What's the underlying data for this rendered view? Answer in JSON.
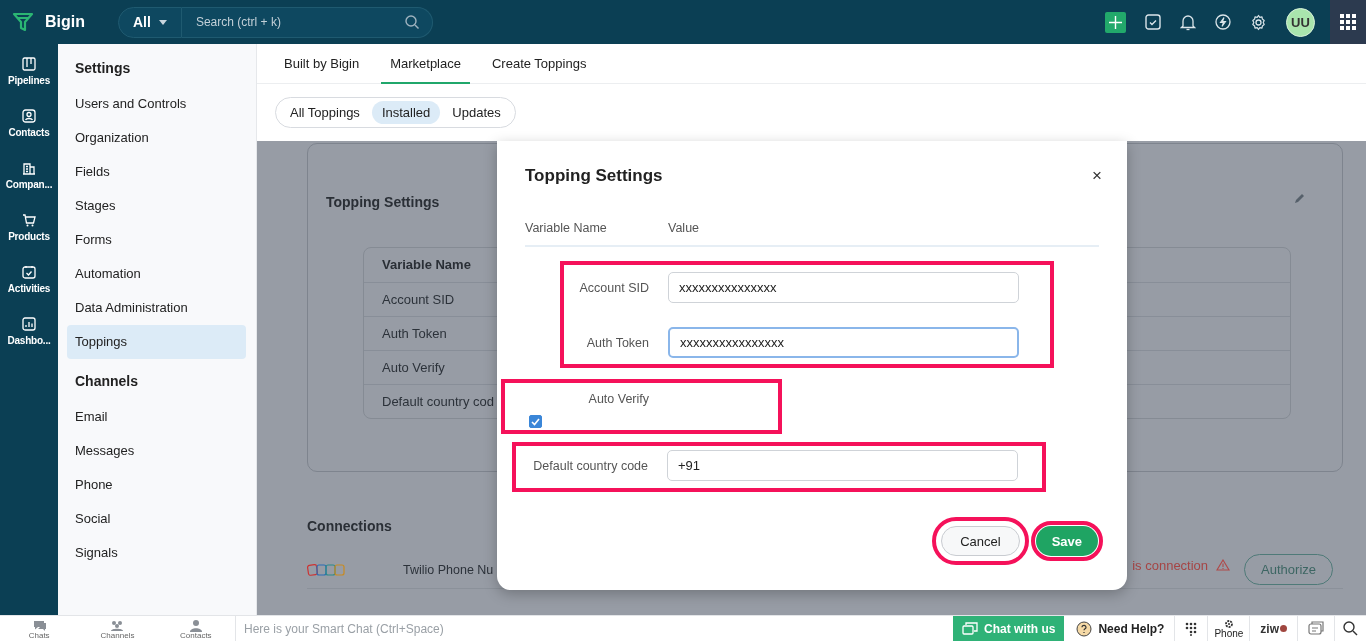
{
  "app": {
    "name": "Bigin"
  },
  "search": {
    "scope": "All",
    "placeholder": "Search (ctrl + k)"
  },
  "user": {
    "initials": "UU"
  },
  "rail": [
    {
      "label": "Pipelines"
    },
    {
      "label": "Contacts"
    },
    {
      "label": "Compan..."
    },
    {
      "label": "Products"
    },
    {
      "label": "Activities"
    },
    {
      "label": "Dashbo..."
    }
  ],
  "settings_nav": [
    {
      "heading": "Settings",
      "items": [
        {
          "label": "Users and Controls",
          "selected": false
        },
        {
          "label": "Organization",
          "selected": false
        },
        {
          "label": "Fields",
          "selected": false
        },
        {
          "label": "Stages",
          "selected": false
        },
        {
          "label": "Forms",
          "selected": false
        },
        {
          "label": "Automation",
          "selected": false
        },
        {
          "label": "Data Administration",
          "selected": false
        },
        {
          "label": "Toppings",
          "selected": true
        }
      ]
    },
    {
      "heading": "Channels",
      "items": [
        {
          "label": "Email",
          "selected": false
        },
        {
          "label": "Messages",
          "selected": false
        },
        {
          "label": "Phone",
          "selected": false
        },
        {
          "label": "Social",
          "selected": false
        },
        {
          "label": "Signals",
          "selected": false
        }
      ]
    }
  ],
  "tabs": [
    {
      "label": "Built by Bigin",
      "selected": false
    },
    {
      "label": "Marketplace",
      "selected": true
    },
    {
      "label": "Create Toppings",
      "selected": false
    }
  ],
  "filters": [
    {
      "label": "All Toppings",
      "selected": false
    },
    {
      "label": "Installed",
      "selected": true
    },
    {
      "label": "Updates",
      "selected": false
    }
  ],
  "topping_panel": {
    "title": "Topping Settings",
    "header": "Variable Name",
    "rows": [
      "Account SID",
      "Auth Token",
      "Auto Verify",
      "Default country cod"
    ]
  },
  "connections": {
    "title": "Connections",
    "items": [
      {
        "name": "Twilio Phone Nu",
        "status": "is connection",
        "action": "Authorize"
      }
    ]
  },
  "dialog": {
    "title": "Topping Settings",
    "close": "×",
    "columns": [
      "Variable Name",
      "Value"
    ],
    "groups": [
      {
        "highlighted": true,
        "fields": [
          {
            "kind": "text",
            "label": "Account SID",
            "value": "xxxxxxxxxxxxxxx",
            "focused": false
          },
          {
            "kind": "text",
            "label": "Auth Token",
            "value": "xxxxxxxxxxxxxxxx",
            "focused": true
          }
        ]
      },
      {
        "highlighted": true,
        "fields": [
          {
            "kind": "checkbox",
            "label": "Auto Verify",
            "checked": true
          }
        ]
      },
      {
        "highlighted": true,
        "fields": [
          {
            "kind": "text",
            "label": "Default country code",
            "value": "+91",
            "focused": false
          }
        ]
      }
    ],
    "buttons": [
      {
        "label": "Cancel",
        "kind": "secondary",
        "highlighted": true
      },
      {
        "label": "Save",
        "kind": "primary",
        "highlighted": true
      }
    ]
  },
  "bottom_bar": {
    "shortcuts": [
      {
        "label": "Chats"
      },
      {
        "label": "Channels"
      },
      {
        "label": "Contacts"
      }
    ],
    "chat_placeholder": "Here is your Smart Chat (Ctrl+Space)",
    "chat_button": "Chat with us",
    "help": "Need Help?",
    "phone": "Phone",
    "brand": "ziw"
  }
}
